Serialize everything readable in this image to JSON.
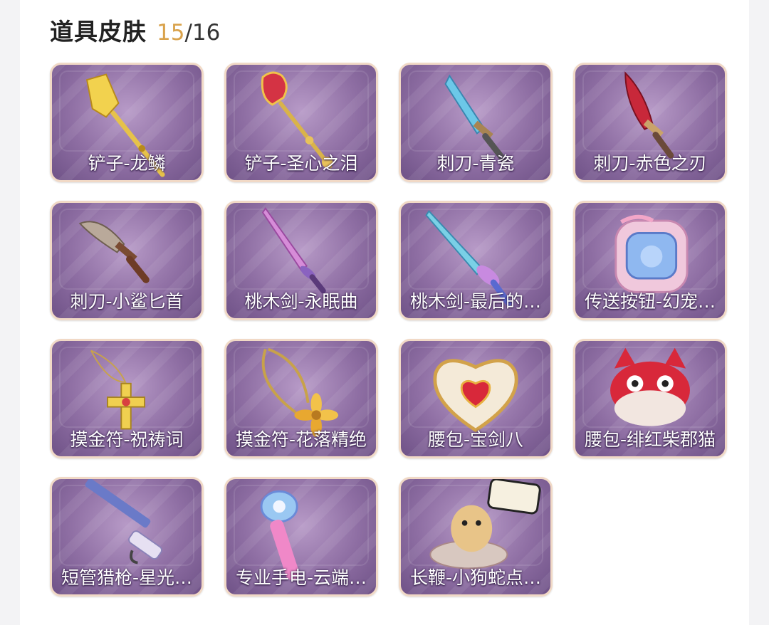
{
  "header": {
    "title": "道具皮肤",
    "owned": "15",
    "total_text": "/16"
  },
  "items": [
    {
      "label": "铲子-龙鳞",
      "icon": "shovel-icon"
    },
    {
      "label": "铲子-圣心之泪",
      "icon": "shovel-icon"
    },
    {
      "label": "刺刀-青瓷",
      "icon": "knife-icon"
    },
    {
      "label": "刺刀-赤色之刃",
      "icon": "knife-icon"
    },
    {
      "label": "刺刀-小鲨匕首",
      "icon": "shark-dagger-icon"
    },
    {
      "label": "桃木剑-永眠曲",
      "icon": "sword-icon"
    },
    {
      "label": "桃木剑-最后的…",
      "icon": "sword-icon"
    },
    {
      "label": "传送按钮-幻宠…",
      "icon": "teleport-button-icon"
    },
    {
      "label": "摸金符-祝祷词",
      "icon": "amulet-icon"
    },
    {
      "label": "摸金符-花落精绝",
      "icon": "amulet-icon"
    },
    {
      "label": "腰包-宝剑八",
      "icon": "heart-pouch-icon"
    },
    {
      "label": "腰包-绯红柴郡猫",
      "icon": "cat-pouch-icon"
    },
    {
      "label": "短管猎枪-星光…",
      "icon": "shotgun-icon"
    },
    {
      "label": "专业手电-云端…",
      "icon": "flashlight-icon"
    },
    {
      "label": "长鞭-小狗蛇点…",
      "icon": "snake-whip-icon"
    }
  ],
  "colors": {
    "accent": "#d9a24b",
    "card_border": "#f1d9c6",
    "card_bg": "#8e6ea3"
  }
}
